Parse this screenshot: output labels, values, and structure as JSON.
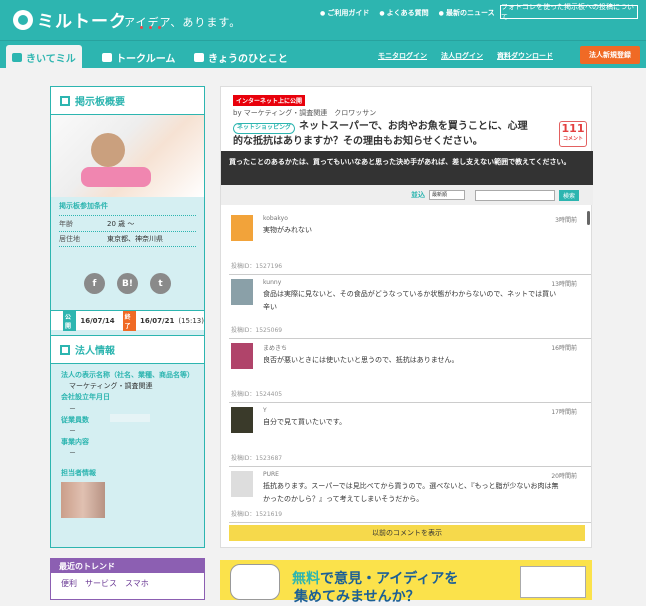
{
  "brand": {
    "name": "ミルトーク",
    "tagline": "アイデア、あります。"
  },
  "toplinks": [
    "ご利用ガイド",
    "よくある質問",
    "最新のニュース"
  ],
  "header_button": "フォトコレを使った掲示板への投稿について",
  "nav": {
    "tabs": [
      "きいてミル",
      "トークルーム",
      "きょうのひとこと"
    ],
    "links": [
      "モニタログイン",
      "法人ログイン",
      "資料ダウンロード"
    ],
    "register": "法人新規登録"
  },
  "side": {
    "board_title": "掲示板概要",
    "conditions_title": "掲示板参加条件",
    "conditions": [
      {
        "k": "年齢",
        "v": "20 歳 〜"
      },
      {
        "k": "居住地",
        "v": "東京都、神奈川県"
      }
    ],
    "social": [
      "f",
      "B!",
      "t"
    ],
    "dates": {
      "open_label": "公開",
      "open": "16/07/14",
      "close_label": "終了",
      "close": "16/07/21",
      "close_time": "(15:13)"
    },
    "corp_title": "法人情報",
    "corp": [
      {
        "k": "法人の表示名称（社名、業種、商品名等）",
        "v": "マーケティング・調査関連"
      },
      {
        "k": "会社設立年月日",
        "v": "－"
      },
      {
        "k": "従業員数",
        "v": "－"
      },
      {
        "k": "事業内容",
        "v": "－"
      }
    ],
    "tantou": "担当者情報"
  },
  "trend": {
    "title": "最近のトレンド",
    "tags": [
      "便利",
      "サービス",
      "スマホ"
    ]
  },
  "post": {
    "badge": "インターネット上に公開",
    "by": "by マーケティング・調査関連　クロワッサン",
    "category": "ネットショッピング",
    "title": "ネットスーパーで、お肉やお魚を買うことに、心理的な抵抗はありますか？その理由もお知らせください。",
    "count": "111",
    "count_label": "コメント",
    "desc": "買ったことのあるかたは、買ってもいいなあと思った決め手があれば、差し支えない範囲で教えてください。"
  },
  "search": {
    "sort_label": "並込",
    "sort_value": "最新順",
    "button": "検索"
  },
  "comments": [
    {
      "user": "kobakyo",
      "time": "3時間前",
      "body": "実物がみれない",
      "id": "投稿ID：1527196",
      "color": "#f2a33a"
    },
    {
      "user": "kunny",
      "time": "13時間前",
      "body": "食品は実際に見ないと、その食品がどうなっているか状態がわからないので、ネットでは買い辛い",
      "id": "投稿ID：1525069",
      "color": "#8aa0a8"
    },
    {
      "user": "まめきち",
      "time": "16時間前",
      "body": "良否が悪いときには使いたいと思うので、抵抗はありません。",
      "id": "投稿ID：1524405",
      "color": "#b0446a"
    },
    {
      "user": "Y",
      "time": "17時間前",
      "body": "自分で見て買いたいです。",
      "id": "投稿ID：1523687",
      "color": "#3a3a2a"
    },
    {
      "user": "PURE",
      "time": "20時間前",
      "body": "抵抗あります。スーパーでは見比べてから買うので。選べないと、『もっと脂が少ないお肉は無かったのかしら？』って考えてしまいそうだから。",
      "id": "投稿ID：1521619",
      "color": "#dddddd"
    }
  ],
  "prev_button": "以前のコメントを表示",
  "ad": {
    "free": "無料",
    "line1": "で意見・アイディアを",
    "line2": "集めてみませんか？"
  }
}
